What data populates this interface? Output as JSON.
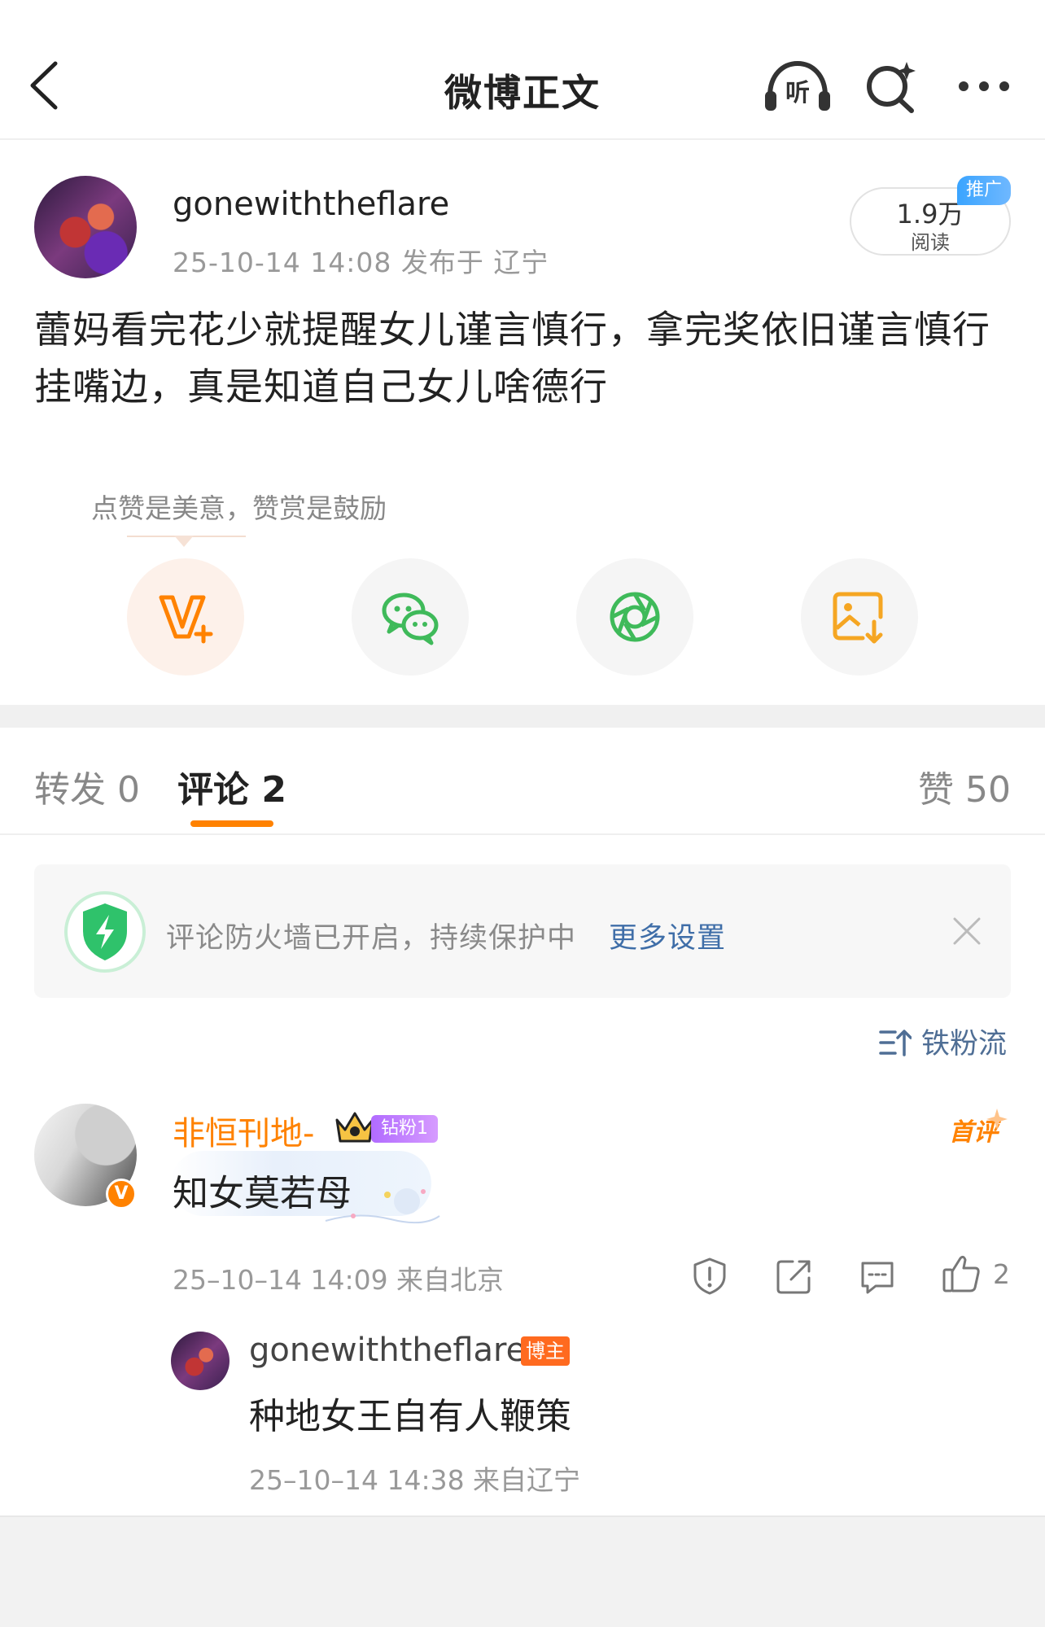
{
  "header": {
    "title": "微博正文",
    "listen_label": "听"
  },
  "post": {
    "username": "gonewiththeflare",
    "meta": "25-10-14 14:08  发布于 辽宁",
    "read_count": "1.9万",
    "read_label": "阅读",
    "promo_tag": "推广",
    "body": "蕾妈看完花少就提醒女儿谨言慎行，拿完奖依旧谨言慎行挂嘴边，真是知道自己女儿啥德行"
  },
  "reward": {
    "tip": "点赞是美意，赞赏是鼓励",
    "buttons": [
      "v-reward",
      "wechat",
      "moments",
      "save-image"
    ]
  },
  "tabs": {
    "repost": "转发 0",
    "comment": "评论 2",
    "like": "赞 50"
  },
  "firewall": {
    "text": "评论防火墙已开启，持续保护中",
    "link": "更多设置"
  },
  "sort": {
    "label": "铁粉流"
  },
  "comments": [
    {
      "name": "非恒刊地-",
      "verified": "V",
      "fan_badge": "钻粉1",
      "first_tag": "首评",
      "text": "知女莫若母",
      "meta": "25–10–14 14:09  来自北京",
      "likes": "2",
      "replies": [
        {
          "name": "gonewiththeflare",
          "owner_badge": "博主",
          "text": "种地女王自有人鞭策",
          "meta": "25–10–14 14:38  来自辽宁"
        }
      ]
    }
  ],
  "colors": {
    "accent": "#ff8200",
    "link": "#3f6ea8",
    "muted": "#999999",
    "wechat_green": "#3fba5a",
    "promo_blue": "#3aa4ff"
  },
  "icons": [
    "back-icon",
    "listen-icon",
    "search-icon",
    "more-icon",
    "shield-icon",
    "close-icon",
    "sort-icon",
    "crown-icon",
    "report-icon",
    "share-icon",
    "reply-icon",
    "like-icon"
  ]
}
